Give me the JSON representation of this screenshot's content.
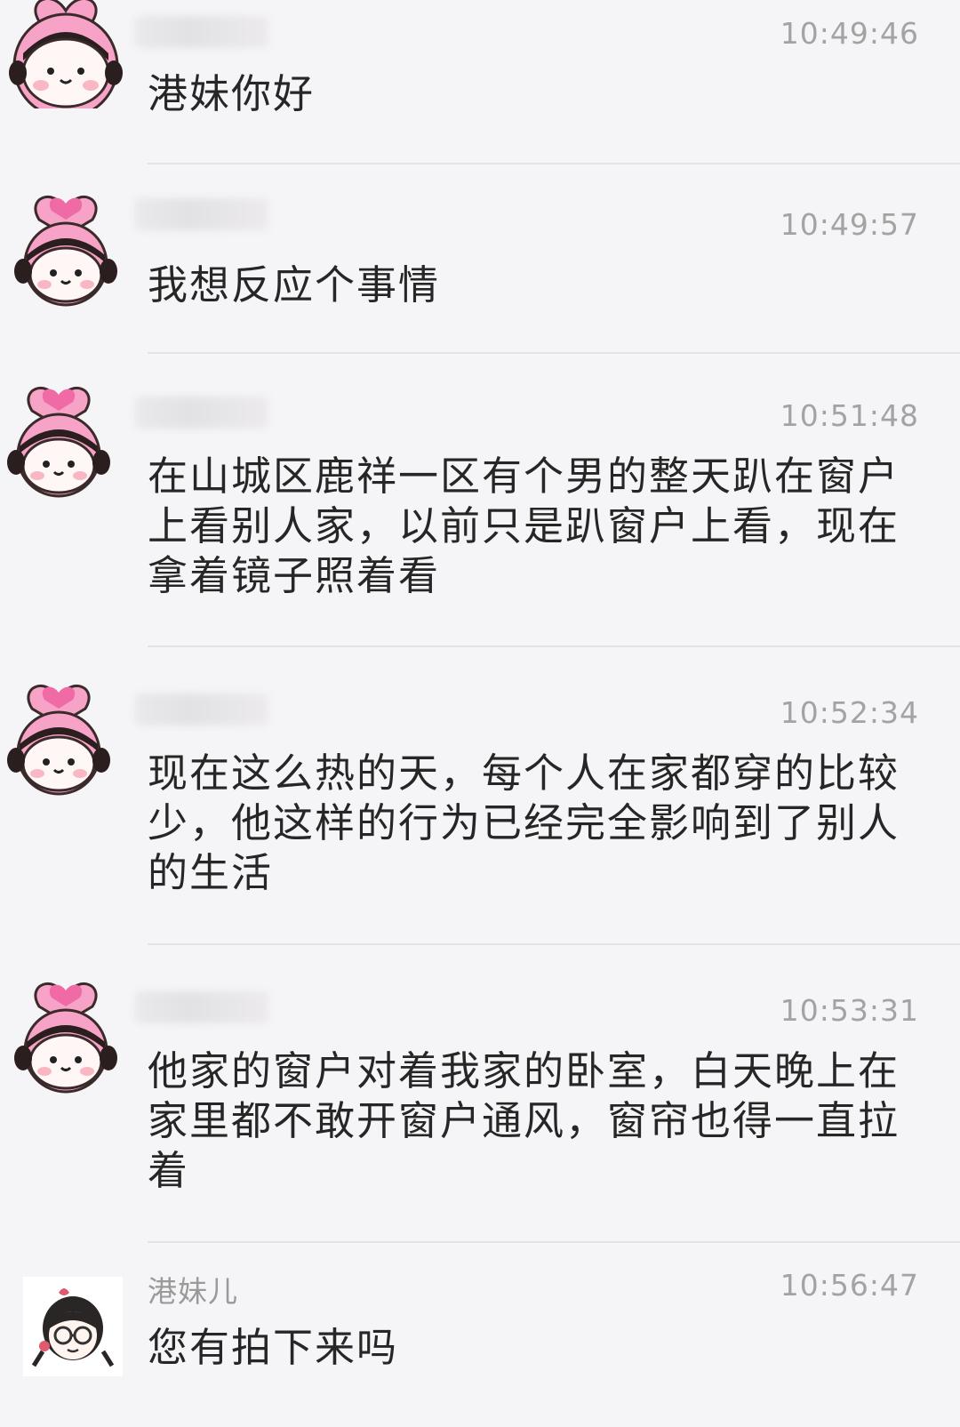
{
  "messages": [
    {
      "sender": "",
      "time": "10:49:46",
      "text": "港妹你好"
    },
    {
      "sender": "",
      "time": "10:49:57",
      "text": "我想反应个事情"
    },
    {
      "sender": "",
      "time": "10:51:48",
      "text": "在山城区鹿祥一区有个男的整天趴在窗户上看别人家，以前只是趴窗户上看，现在拿着镜子照着看"
    },
    {
      "sender": "",
      "time": "10:52:34",
      "text": "现在这么热的天，每个人在家都穿的比较少，他这样的行为已经完全影响到了别人的生活"
    },
    {
      "sender": "",
      "time": "10:53:31",
      "text": "他家的窗户对着我家的卧室，白天晚上在家里都不敢开窗户通风，窗帘也得一直拉着"
    },
    {
      "sender": "港妹儿",
      "time": "10:56:47",
      "text": "您有拍下来吗"
    }
  ],
  "colors": {
    "background": "#f5f4f6",
    "avatar_pink": "#f7a3c8",
    "avatar_heart": "#f06aa6",
    "divider": "#e3e2e5"
  },
  "icons": {
    "user_avatar": "pink-heart-girl-avatar",
    "agent_avatar": "girl-with-glasses-avatar"
  }
}
